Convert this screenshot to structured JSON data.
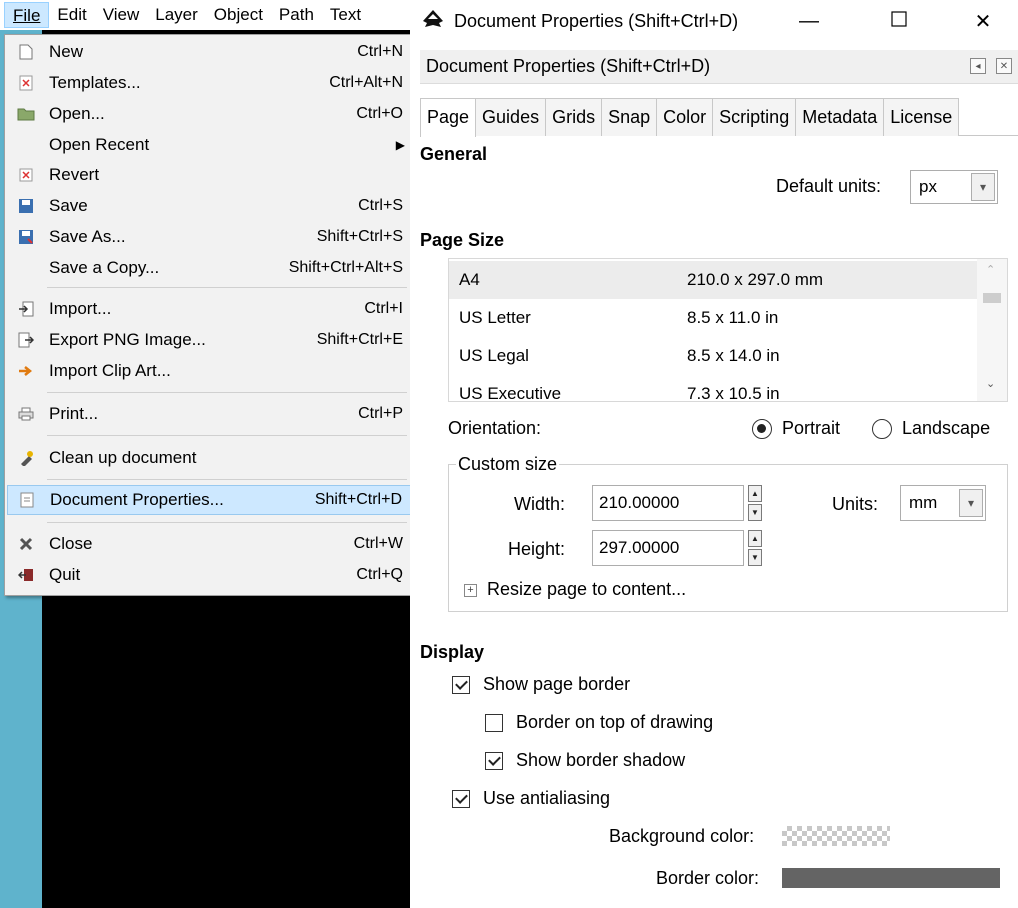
{
  "menubar": {
    "items": [
      "File",
      "Edit",
      "View",
      "Layer",
      "Object",
      "Path",
      "Text"
    ]
  },
  "file_menu": {
    "items": [
      {
        "label": "New",
        "shortcut": "Ctrl+N",
        "icon": "new-doc-icon"
      },
      {
        "label": "Templates...",
        "shortcut": "Ctrl+Alt+N",
        "icon": "templates-icon"
      },
      {
        "label": "Open...",
        "shortcut": "Ctrl+O",
        "icon": "open-folder-icon"
      },
      {
        "label": "Open Recent",
        "shortcut": "",
        "icon": ""
      },
      {
        "label": "Revert",
        "shortcut": "",
        "icon": "revert-icon"
      },
      {
        "label": "Save",
        "shortcut": "Ctrl+S",
        "icon": "save-icon"
      },
      {
        "label": "Save As...",
        "shortcut": "Shift+Ctrl+S",
        "icon": "save-as-icon"
      },
      {
        "label": "Save a Copy...",
        "shortcut": "Shift+Ctrl+Alt+S",
        "icon": ""
      },
      {
        "label": "Import...",
        "shortcut": "Ctrl+I",
        "icon": "import-icon"
      },
      {
        "label": "Export PNG Image...",
        "shortcut": "Shift+Ctrl+E",
        "icon": "export-icon"
      },
      {
        "label": "Import Clip Art...",
        "shortcut": "",
        "icon": "clip-art-icon"
      },
      {
        "label": "Print...",
        "shortcut": "Ctrl+P",
        "icon": "print-icon"
      },
      {
        "label": "Clean up document",
        "shortcut": "",
        "icon": "clean-up-icon"
      },
      {
        "label": "Document Properties...",
        "shortcut": "Shift+Ctrl+D",
        "icon": "document-properties-icon"
      },
      {
        "label": "Close",
        "shortcut": "Ctrl+W",
        "icon": "close-doc-icon"
      },
      {
        "label": "Quit",
        "shortcut": "Ctrl+Q",
        "icon": "quit-icon"
      }
    ]
  },
  "window": {
    "title": "Document Properties (Shift+Ctrl+D)",
    "dock_title": "Document Properties (Shift+Ctrl+D)"
  },
  "tabs": [
    "Page",
    "Guides",
    "Grids",
    "Snap",
    "Color",
    "Scripting",
    "Metadata",
    "License"
  ],
  "general": {
    "title": "General",
    "default_units_label": "Default units:",
    "default_units_value": "px"
  },
  "page_size": {
    "title": "Page Size",
    "rows": [
      {
        "name": "A4",
        "size": "210.0 x 297.0 mm"
      },
      {
        "name": "US Letter",
        "size": "8.5 x 11.0 in"
      },
      {
        "name": "US Legal",
        "size": "8.5 x 14.0 in"
      },
      {
        "name": "US Executive",
        "size": "7.3 x 10.5 in"
      }
    ],
    "orientation_label": "Orientation:",
    "portrait": "Portrait",
    "landscape": "Landscape"
  },
  "custom_size": {
    "legend": "Custom size",
    "width_label": "Width:",
    "width_value": "210.00000",
    "height_label": "Height:",
    "height_value": "297.00000",
    "units_label": "Units:",
    "units_value": "mm",
    "resize": "Resize page to content..."
  },
  "display": {
    "title": "Display",
    "show_page_border": "Show page border",
    "border_on_top": "Border on top of drawing",
    "show_border_shadow": "Show border shadow",
    "use_antialiasing": "Use antialiasing",
    "background_color_label": "Background color:",
    "border_color_label": "Border color:"
  },
  "colors": {
    "accent_highlight": "#cde8ff",
    "canvas_strip": "#5fb3cc",
    "border_color": "#646464"
  }
}
